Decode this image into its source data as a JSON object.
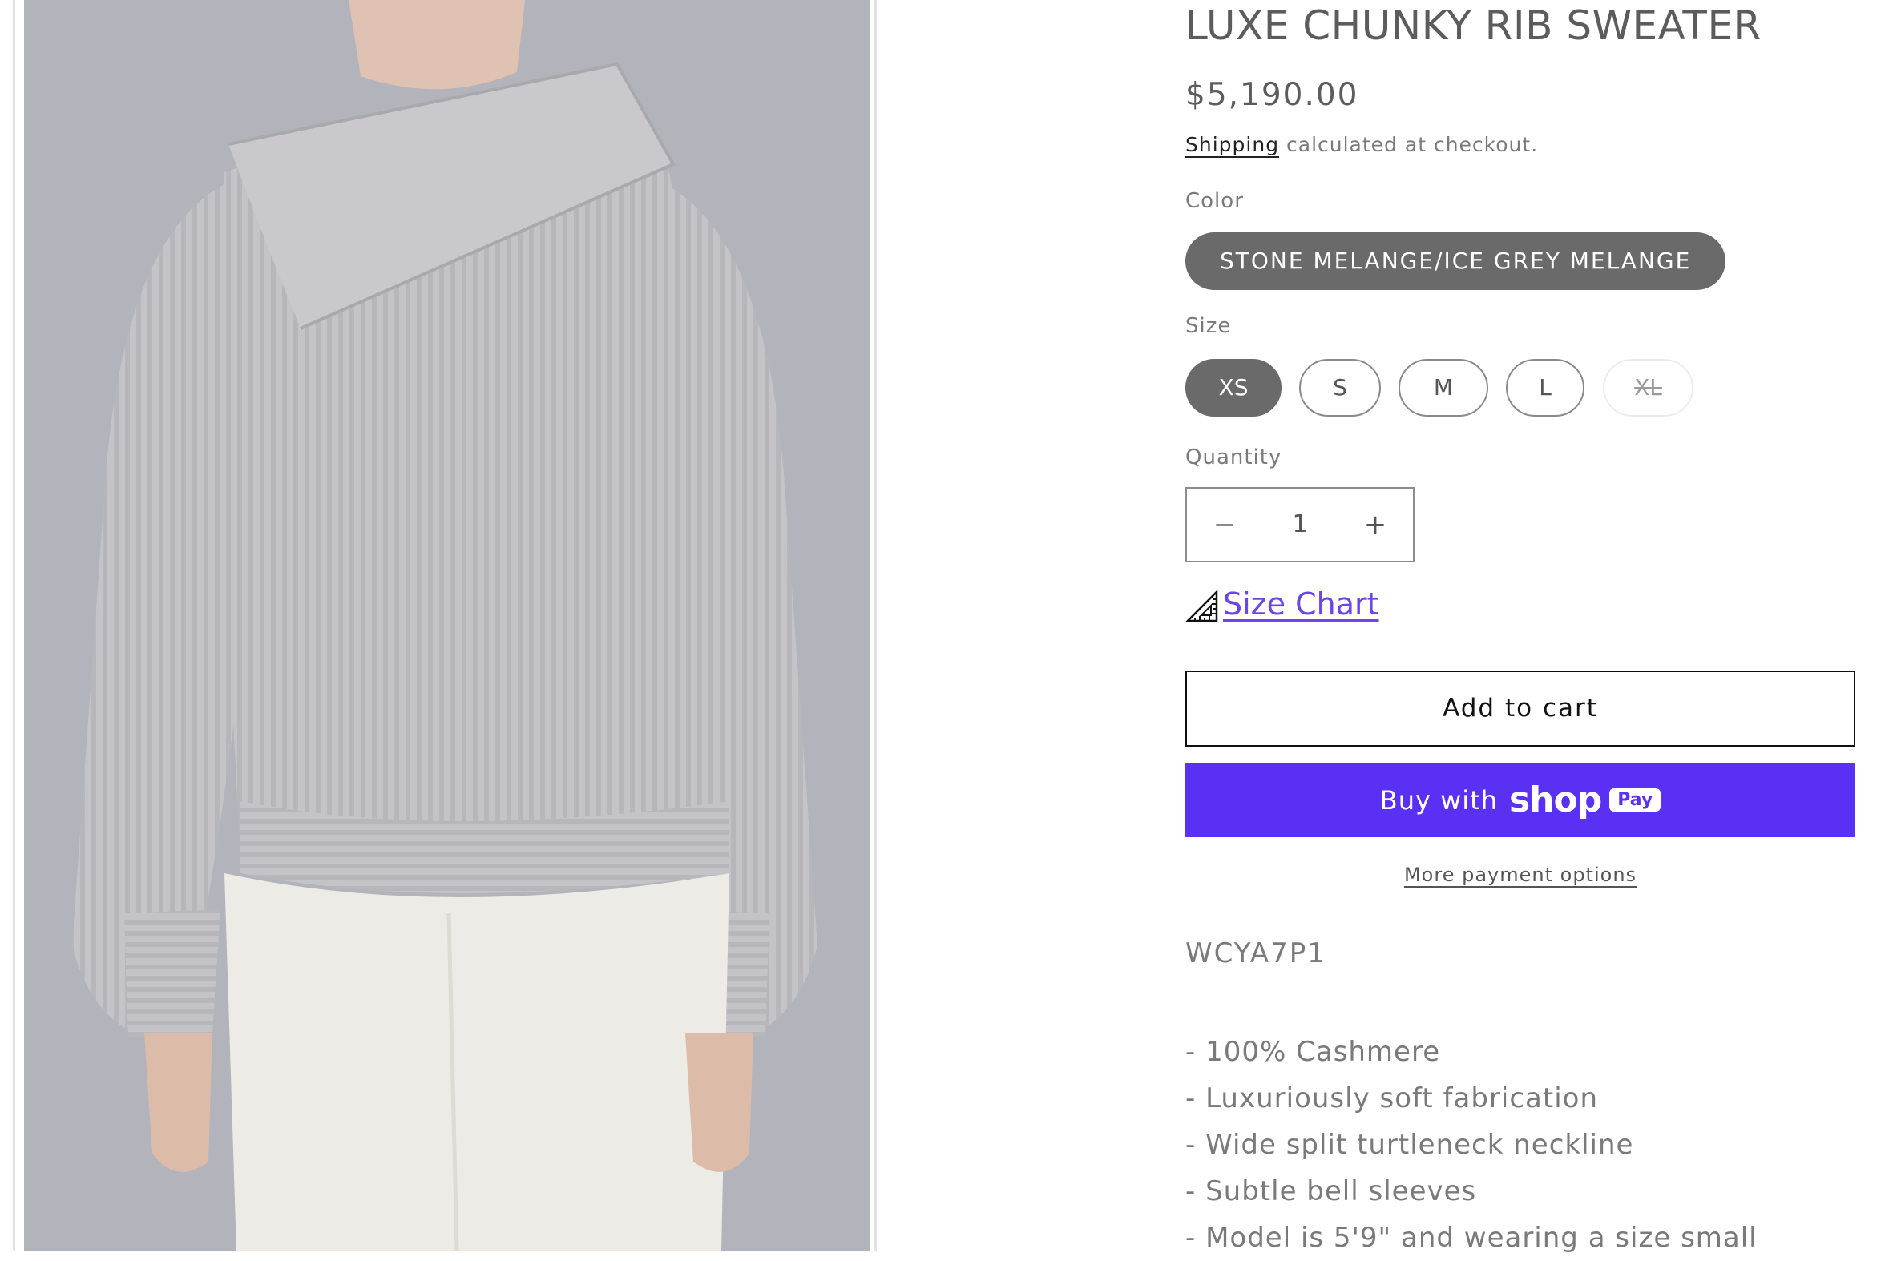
{
  "product": {
    "title": "LUXE CHUNKY RIB SWEATER",
    "price": "$5,190.00",
    "shipping_link": "Shipping",
    "shipping_rest": " calculated at checkout.",
    "color_label": "Color",
    "color_value": "STONE MELANGE/ICE GREY MELANGE",
    "size_label": "Size",
    "sizes": [
      {
        "label": "XS",
        "state": "selected"
      },
      {
        "label": "S",
        "state": "available"
      },
      {
        "label": "M",
        "state": "available"
      },
      {
        "label": "L",
        "state": "available"
      },
      {
        "label": "XL",
        "state": "unavailable"
      }
    ],
    "quantity_label": "Quantity",
    "quantity_value": "1",
    "quantity_minus": "−",
    "quantity_plus": "+",
    "size_chart_label": "Size Chart",
    "add_to_cart_label": "Add to cart",
    "buy_with_label": "Buy with",
    "shop_logo": "shop",
    "pay_badge": "Pay",
    "more_payment_label": "More payment options",
    "sku": "WCYA7P1",
    "features": [
      "- 100% Cashmere",
      "- Luxuriously soft fabrication",
      "- Wide split turtleneck neckline",
      "- Subtle bell sleeves",
      "- Model is 5'9\" and wearing a size small"
    ]
  },
  "colors": {
    "accent_purple": "#5a31f4",
    "link_purple": "#6b45e6",
    "selected_pill": "#6a6a6a"
  },
  "icons": {
    "ruler": "ruler-icon"
  }
}
